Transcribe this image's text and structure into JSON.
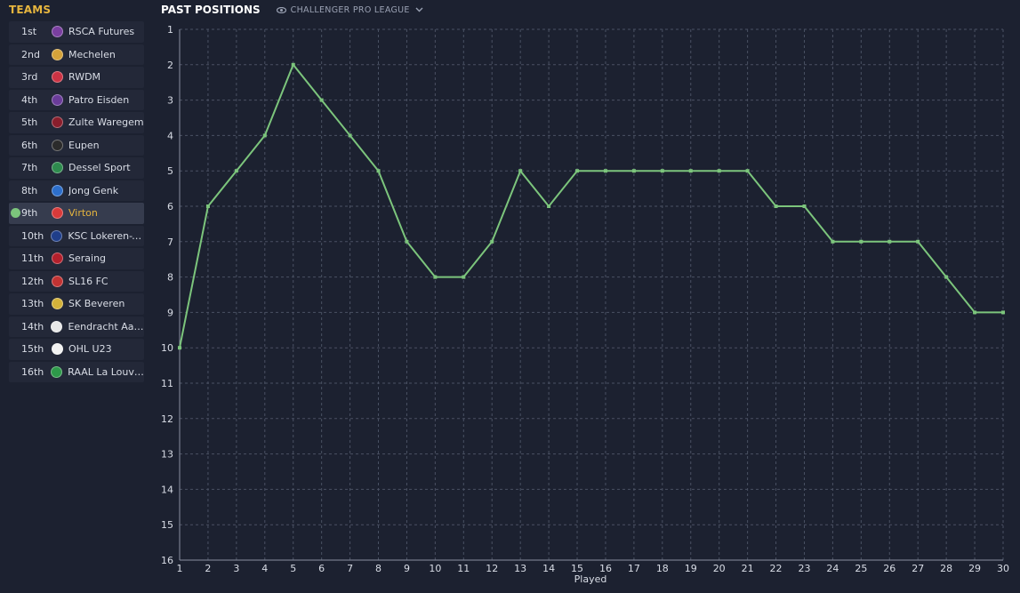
{
  "sidebar": {
    "title": "TEAMS",
    "teams": [
      {
        "pos": "1st",
        "name": "RSCA Futures",
        "color": "#7a3fa0",
        "selected": false
      },
      {
        "pos": "2nd",
        "name": "Mechelen",
        "color": "#d4a23a",
        "selected": false
      },
      {
        "pos": "3rd",
        "name": "RWDM",
        "color": "#cc3344",
        "selected": false
      },
      {
        "pos": "4th",
        "name": "Patro Eisden",
        "color": "#6a3c9a",
        "selected": false
      },
      {
        "pos": "5th",
        "name": "Zulte Waregem",
        "color": "#8a1e2c",
        "selected": false
      },
      {
        "pos": "6th",
        "name": "Eupen",
        "color": "#2b2b2b",
        "selected": false
      },
      {
        "pos": "7th",
        "name": "Dessel Sport",
        "color": "#2e8b4e",
        "selected": false
      },
      {
        "pos": "8th",
        "name": "Jong Genk",
        "color": "#2d6fcc",
        "selected": false
      },
      {
        "pos": "9th",
        "name": "Virton",
        "color": "#d93a3a",
        "selected": true
      },
      {
        "pos": "10th",
        "name": "KSC Lokeren-T...",
        "color": "#1f3e8a",
        "selected": false
      },
      {
        "pos": "11th",
        "name": "Seraing",
        "color": "#b3202c",
        "selected": false
      },
      {
        "pos": "12th",
        "name": "SL16 FC",
        "color": "#c23333",
        "selected": false
      },
      {
        "pos": "13th",
        "name": "SK Beveren",
        "color": "#d4b23a",
        "selected": false
      },
      {
        "pos": "14th",
        "name": "Eendracht Aalst",
        "color": "#e8e8e8",
        "selected": false
      },
      {
        "pos": "15th",
        "name": "OHL U23",
        "color": "#f2f2f2",
        "selected": false
      },
      {
        "pos": "16th",
        "name": "RAAL La Louvi...",
        "color": "#2e9a4a",
        "selected": false
      }
    ]
  },
  "header": {
    "title": "PAST POSITIONS",
    "league": "CHALLENGER PRO LEAGUE",
    "league_icon": "eye-icon",
    "dropdown_icon": "chevron-down-icon"
  },
  "colors": {
    "accent": "#e6b53e",
    "line": "#7cc57c",
    "grid": "#4a5163",
    "background": "#1c2130"
  },
  "chart_data": {
    "type": "line",
    "title": "PAST POSITIONS",
    "xlabel": "Played",
    "ylabel": "",
    "x": [
      1,
      2,
      3,
      4,
      5,
      6,
      7,
      8,
      9,
      10,
      11,
      12,
      13,
      14,
      15,
      16,
      17,
      18,
      19,
      20,
      21,
      22,
      23,
      24,
      25,
      26,
      27,
      28,
      29,
      30
    ],
    "xlim": [
      1,
      30
    ],
    "ylim": [
      1,
      16
    ],
    "y_inverted": true,
    "y_ticks": [
      1,
      2,
      3,
      4,
      5,
      6,
      7,
      8,
      9,
      10,
      11,
      12,
      13,
      14,
      15,
      16
    ],
    "grid": true,
    "series": [
      {
        "values": [
          10,
          6,
          5,
          4,
          2,
          3,
          4,
          5,
          7,
          8,
          8,
          7,
          5,
          6,
          5,
          5,
          5,
          5,
          5,
          5,
          5,
          6,
          6,
          7,
          7,
          7,
          7,
          8,
          9,
          9
        ],
        "color": "#7cc57c"
      }
    ]
  }
}
